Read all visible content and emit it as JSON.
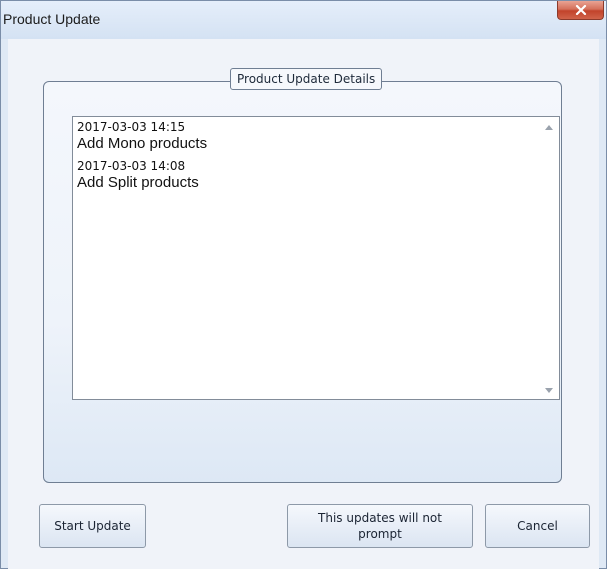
{
  "window": {
    "title": "Product Update",
    "close_icon": "close-icon"
  },
  "group": {
    "legend": "Product Update Details"
  },
  "updates": [
    {
      "date": "2017-03-03 14:15",
      "text": "Add Mono products"
    },
    {
      "date": "2017-03-03 14:08",
      "text": "Add Split products"
    }
  ],
  "buttons": {
    "start_update": "Start Update",
    "no_prompt": "This updates will not prompt",
    "cancel": "Cancel"
  },
  "colors": {
    "window_frame": "#dfe9f5",
    "close_button": "#c9503a",
    "client_bg": "#f0f3f9"
  }
}
